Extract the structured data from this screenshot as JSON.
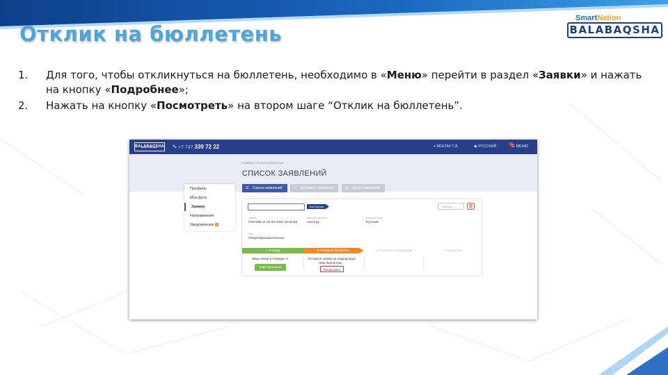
{
  "slide": {
    "title": "Отклик на бюллетень",
    "brand": {
      "smart": "Smart",
      "nation": "Nation",
      "name": "BALABAQSHA"
    },
    "instructions": [
      {
        "num": "1.",
        "parts": [
          "Для того, чтобы откликнуться на бюллетень, необходимо в «",
          "Меню",
          "» перейти в раздел «",
          "Заявки",
          "» и нажать на кнопку «",
          "Подробнее",
          "»;"
        ]
      },
      {
        "num": "2.",
        "parts": [
          "Нажать на кнопку «",
          "Посмотреть",
          "» на втором шаге “Отклик на бюллетень”."
        ]
      }
    ]
  },
  "app": {
    "logo": "BALABAQSHA",
    "logo_small": "Smart Nation",
    "phone_prefix": "+7 747",
    "phone_number": "339 72 22",
    "nav": {
      "user": "КЕНТАУ Г.А.",
      "language": "РУССКИЙ",
      "menu": "МЕНЮ"
    },
    "breadcrumb": "Главная  /  Список заявлений",
    "page_title": "СПИСОК ЗАЯВЛЕНИЙ",
    "tabs": [
      "Список заявлений",
      "Добавить заявление",
      "Архив заявлений"
    ],
    "sidebar": [
      {
        "label": "Профиль"
      },
      {
        "label": "Мои дети"
      },
      {
        "label": "Заявки"
      },
      {
        "label": "Направления"
      },
      {
        "label": "Уведомления",
        "badge": "1"
      }
    ],
    "card": {
      "status": "Был вызов",
      "hide_button": "Скрыть",
      "application_label": "Заявка",
      "application_value": "#287296 от 05.02.2020 16:32:58",
      "city_label": "Населенный пункт",
      "city_value": "г.Кентау",
      "lang_label": "Язык обучения",
      "lang_value": "Русский",
      "type_label": "Тип",
      "type_value": "Общеобразовательная",
      "steps": [
        "Очередь",
        "Отклик на бюллетень",
        "Получение направления",
        "Результаты"
      ],
      "queue_text": "Ваш номер в очереди: 3",
      "queue_button": "Заинтересован",
      "bulletin_text1": "Оставьте заявку на подходящую",
      "bulletin_text2": "Вам бюллетень",
      "view_button": "Посмотреть"
    }
  }
}
